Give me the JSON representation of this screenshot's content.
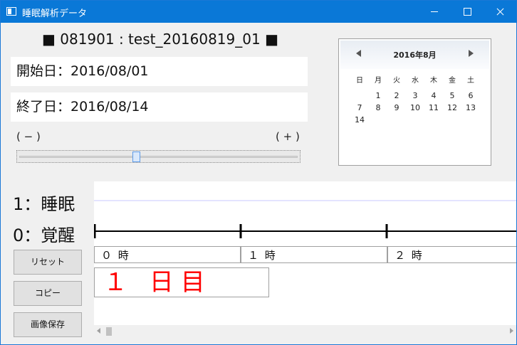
{
  "window": {
    "title": "睡眠解析データ",
    "icon": "app-window-icon",
    "titlebar_color": "#0a78d7"
  },
  "header": {
    "subject_line": "■ 081901 : test_20160819_01 ■"
  },
  "dates": {
    "start": "開始日：2016/08/01",
    "end": "終了日：2016/08/14"
  },
  "zoom": {
    "minus_label": "( − )",
    "plus_label": "( + )",
    "level": 0.42
  },
  "calendar": {
    "title": "2016年8月",
    "weekdays": [
      "日",
      "月",
      "火",
      "水",
      "木",
      "金",
      "土"
    ],
    "weeks": [
      [
        "",
        "1",
        "2",
        "3",
        "4",
        "5",
        "6"
      ],
      [
        "7",
        "8",
        "9",
        "10",
        "11",
        "12",
        "13"
      ],
      [
        "14",
        "",
        "",
        "",
        "",
        "",
        ""
      ]
    ]
  },
  "legend": {
    "sleep": "1：睡眠",
    "wake": "0：覚醒"
  },
  "buttons": {
    "reset": "リセット",
    "copy": "コピー",
    "save_image": "画像保存"
  },
  "timeline": {
    "hours": [
      "０ 時",
      "１ 時",
      "２ 時"
    ],
    "day_label": "１ 日目",
    "day_label_color": "#ff0000",
    "line_color": "#000000",
    "sleep_line_color": "#c8c8ff"
  }
}
